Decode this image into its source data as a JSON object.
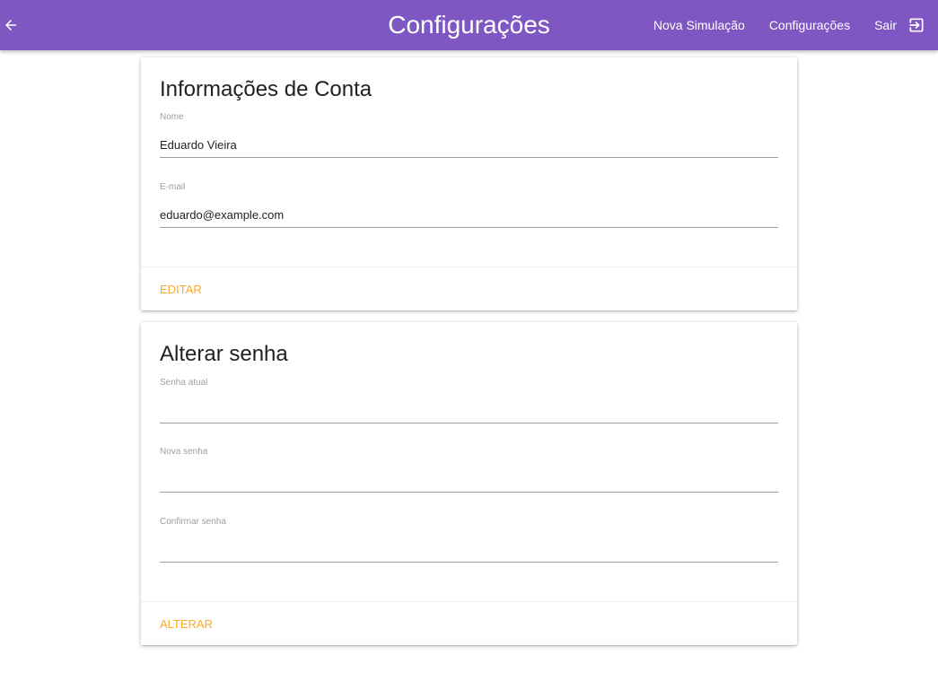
{
  "appbar": {
    "title": "Configurações",
    "nav": {
      "new_simulation": "Nova Simulação",
      "settings": "Configurações",
      "logout": "Sair"
    },
    "color": "#7e57c2"
  },
  "account_card": {
    "title": "Informações de Conta",
    "name_label": "Nome",
    "name_value": "Eduardo Vieira",
    "email_label": "E-mail",
    "email_value": "eduardo@example.com",
    "action": "EDITAR"
  },
  "password_card": {
    "title": "Alterar senha",
    "current_label": "Senha atual",
    "current_value": "",
    "new_label": "Nova senha",
    "new_value": "",
    "confirm_label": "Confirmar senha",
    "confirm_value": "",
    "action": "ALTERAR"
  },
  "icons": {
    "back": "arrow-left-icon",
    "logout": "exit-to-app-icon"
  },
  "colors": {
    "accent": "#ffa726",
    "primary": "#7e57c2"
  }
}
